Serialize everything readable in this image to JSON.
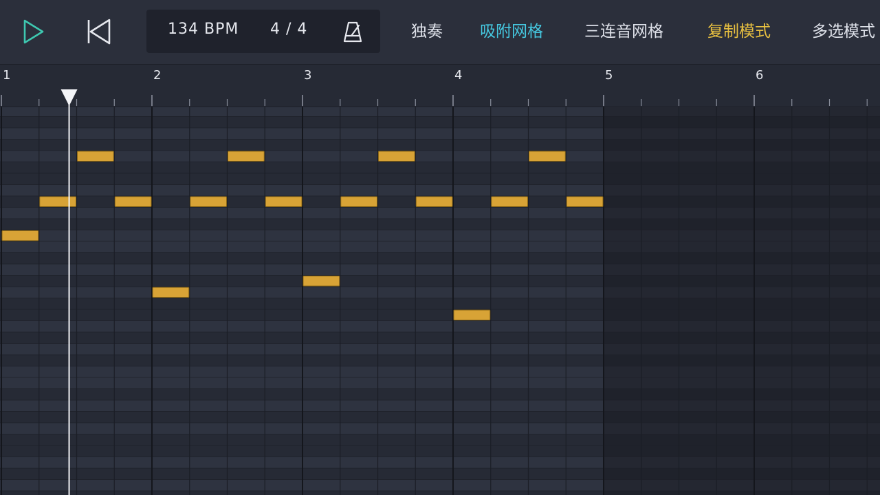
{
  "transport": {
    "bpm_text": "134 BPM",
    "time_signature_text": "4 / 4"
  },
  "modes": {
    "solo": "独奏",
    "snap_grid": "吸附网格",
    "triplet_grid": "三连音网格",
    "copy_mode": "复制模式",
    "multi_select": "多选模式"
  },
  "ruler": {
    "bars": [
      "1",
      "2",
      "3",
      "4",
      "5",
      "6"
    ]
  },
  "playhead": {
    "position_beats": 1.8
  },
  "piano_roll": {
    "loop_end_bar": 5,
    "notes": [
      {
        "start": 0,
        "length": 1,
        "pitch_row": 11
      },
      {
        "start": 1,
        "length": 1,
        "pitch_row": 8
      },
      {
        "start": 2,
        "length": 1,
        "pitch_row": 4
      },
      {
        "start": 3,
        "length": 1,
        "pitch_row": 8
      },
      {
        "start": 4,
        "length": 1,
        "pitch_row": 16
      },
      {
        "start": 5,
        "length": 1,
        "pitch_row": 8
      },
      {
        "start": 6,
        "length": 1,
        "pitch_row": 4
      },
      {
        "start": 7,
        "length": 1,
        "pitch_row": 8
      },
      {
        "start": 8,
        "length": 1,
        "pitch_row": 15
      },
      {
        "start": 9,
        "length": 1,
        "pitch_row": 8
      },
      {
        "start": 10,
        "length": 1,
        "pitch_row": 4
      },
      {
        "start": 11,
        "length": 1,
        "pitch_row": 8
      },
      {
        "start": 12,
        "length": 1,
        "pitch_row": 18
      },
      {
        "start": 13,
        "length": 1,
        "pitch_row": 8
      },
      {
        "start": 14,
        "length": 1,
        "pitch_row": 4
      },
      {
        "start": 15,
        "length": 1,
        "pitch_row": 8
      }
    ]
  },
  "colors": {
    "accent_snap": "#45c8e0",
    "accent_copy": "#e8c040",
    "play_icon": "#3ec8b0",
    "note_fill": "#d8a336"
  }
}
